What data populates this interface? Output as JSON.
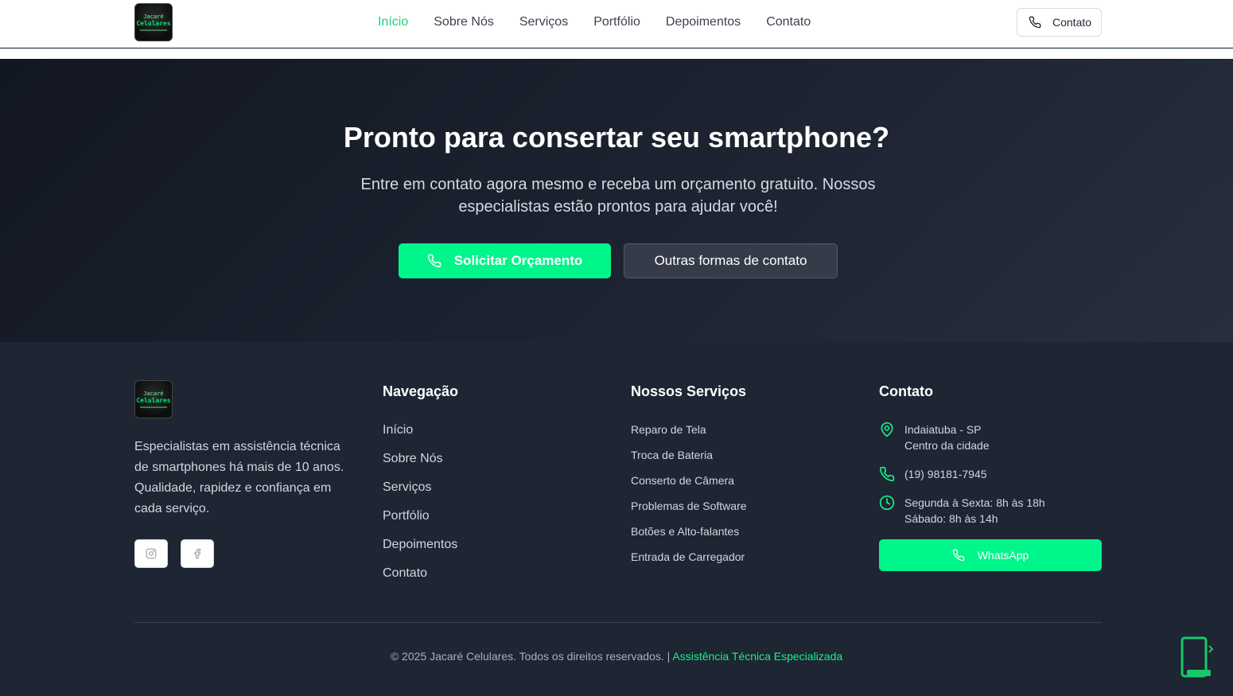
{
  "brand": {
    "logo_line1": "Jacaré",
    "logo_line2": "Celulares",
    "accent_color": "#00f58a"
  },
  "header": {
    "nav": [
      "Início",
      "Sobre Nós",
      "Serviços",
      "Portfólio",
      "Depoimentos",
      "Contato"
    ],
    "active_item": "Início",
    "contact_button": "Contato",
    "contact_icon": "phone-icon"
  },
  "cta": {
    "title": "Pronto para consertar seu smartphone?",
    "subtitle": "Entre em contato agora mesmo e receba um orçamento gratuito. Nossos especialistas estão prontos para ajudar você!",
    "primary_button": "Solicitar Orçamento",
    "secondary_button": "Outras formas de contato"
  },
  "footer": {
    "about": "Especialistas em assistência técnica de smartphones há mais de 10 anos. Qualidade, rapidez e confiança em cada serviço.",
    "social_icons": [
      "instagram-icon",
      "facebook-icon"
    ],
    "navigation": {
      "title": "Navegação",
      "items": [
        "Início",
        "Sobre Nós",
        "Serviços",
        "Portfólio",
        "Depoimentos",
        "Contato"
      ]
    },
    "services": {
      "title": "Nossos Serviços",
      "items": [
        "Reparo de Tela",
        "Troca de Bateria",
        "Conserto de Câmera",
        "Problemas de Software",
        "Botões e Alto-falantes",
        "Entrada de Carregador"
      ]
    },
    "contact": {
      "title": "Contato",
      "location_line1": "Indaiatuba - SP",
      "location_line2": "Centro da cidade",
      "phone": "(19) 98181-7945",
      "hours_line1": "Segunda à Sexta: 8h às 18h",
      "hours_line2": "Sábado: 8h às 14h",
      "whatsapp_button": "WhatsApp"
    },
    "copyright": "© 2025 Jacaré Celulares. Todos os direitos reservados. |",
    "copyright_highlight": "Assistência Técnica Especializada"
  }
}
